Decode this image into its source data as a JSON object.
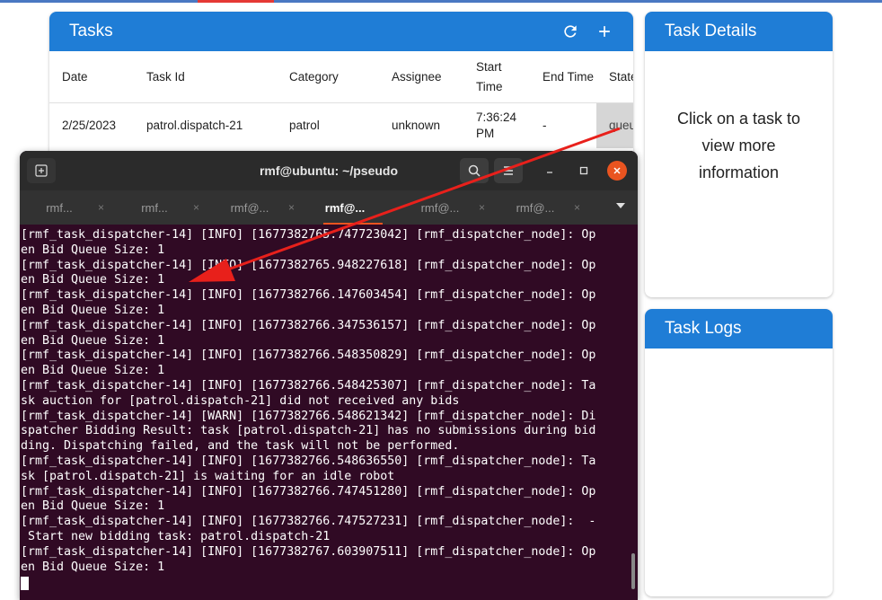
{
  "tasks": {
    "title": "Tasks",
    "columns": [
      "Date",
      "Task Id",
      "Category",
      "Assignee",
      "Start Time",
      "End Time",
      "State"
    ],
    "column_widths": [
      94,
      159,
      114,
      94,
      74,
      74,
      51
    ],
    "rows": [
      {
        "date": "2/25/2023",
        "task_id": "patrol.dispatch-21",
        "category": "patrol",
        "assignee": "unknown",
        "start_time": "7:36:24 PM",
        "end_time": "-",
        "state": "queued"
      }
    ]
  },
  "details": {
    "title": "Task Details",
    "placeholder": "Click on a task to view more information"
  },
  "logs": {
    "title": "Task Logs"
  },
  "terminal": {
    "title": "rmf@ubuntu: ~/pseudo",
    "tabs": [
      {
        "label": "rmf...",
        "active": false
      },
      {
        "label": "rmf...",
        "active": false
      },
      {
        "label": "rmf@...",
        "active": false
      },
      {
        "label": "rmf@...",
        "active": true
      },
      {
        "label": "rmf@...",
        "active": false
      },
      {
        "label": "rmf@...",
        "active": false
      }
    ],
    "lines": [
      "[rmf_task_dispatcher-14] [INFO] [1677382765.747723042] [rmf_dispatcher_node]: Op",
      "en Bid Queue Size: 1",
      "[rmf_task_dispatcher-14] [INFO] [1677382765.948227618] [rmf_dispatcher_node]: Op",
      "en Bid Queue Size: 1",
      "[rmf_task_dispatcher-14] [INFO] [1677382766.147603454] [rmf_dispatcher_node]: Op",
      "en Bid Queue Size: 1",
      "[rmf_task_dispatcher-14] [INFO] [1677382766.347536157] [rmf_dispatcher_node]: Op",
      "en Bid Queue Size: 1",
      "[rmf_task_dispatcher-14] [INFO] [1677382766.548350829] [rmf_dispatcher_node]: Op",
      "en Bid Queue Size: 1",
      "[rmf_task_dispatcher-14] [INFO] [1677382766.548425307] [rmf_dispatcher_node]: Ta",
      "sk auction for [patrol.dispatch-21] did not received any bids",
      "[rmf_task_dispatcher-14] [WARN] [1677382766.548621342] [rmf_dispatcher_node]: Di",
      "spatcher Bidding Result: task [patrol.dispatch-21] has no submissions during bid",
      "ding. Dispatching failed, and the task will not be performed.",
      "[rmf_task_dispatcher-14] [INFO] [1677382766.548636550] [rmf_dispatcher_node]: Ta",
      "sk [patrol.dispatch-21] is waiting for an idle robot",
      "[rmf_task_dispatcher-14] [INFO] [1677382766.747451280] [rmf_dispatcher_node]: Op",
      "en Bid Queue Size: 1",
      "[rmf_task_dispatcher-14] [INFO] [1677382766.747527231] [rmf_dispatcher_node]:  -",
      " Start new bidding task: patrol.dispatch-21",
      "[rmf_task_dispatcher-14] [INFO] [1677382767.603907511] [rmf_dispatcher_node]: Op",
      "en Bid Queue Size: 1"
    ]
  },
  "colors": {
    "header_blue": "#1f7dd6",
    "terminal_bg": "#300a24",
    "arrow_red": "#e8201b",
    "close_orange": "#e95420"
  },
  "icons": {
    "refresh": "refresh-icon",
    "add": "add-icon",
    "new_tab": "new-tab-icon",
    "search": "search-icon",
    "menu": "hamburger-menu-icon",
    "minimize": "minimize-icon",
    "maximize": "maximize-icon",
    "close": "close-icon",
    "tabs_dropdown": "chevron-down-icon"
  }
}
